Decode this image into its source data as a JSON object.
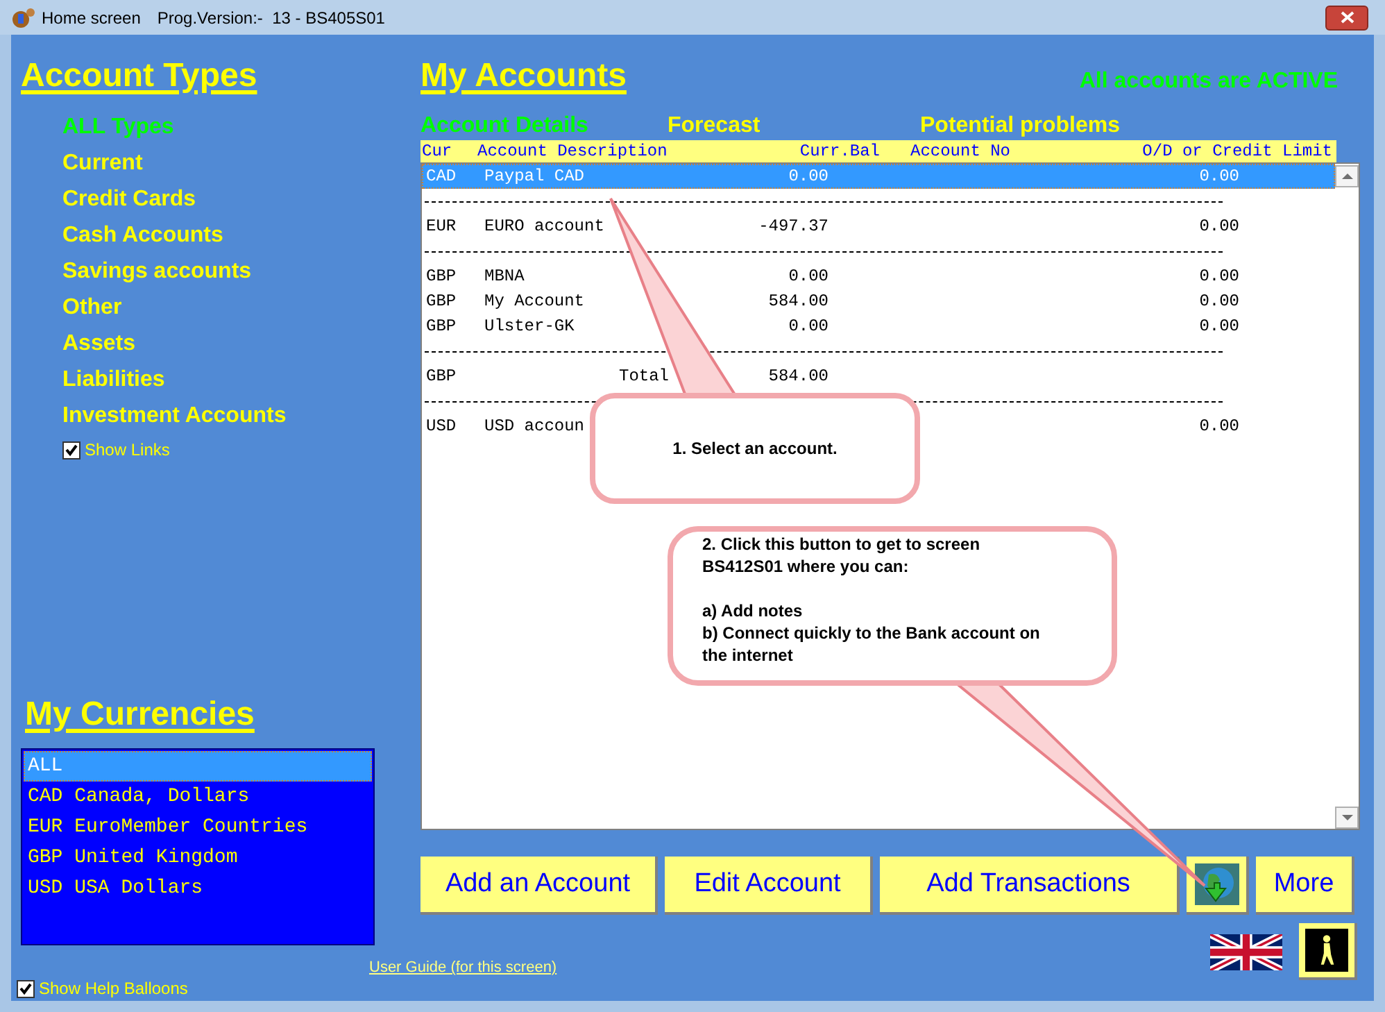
{
  "window": {
    "title": "Home screen",
    "version": "Prog.Version:-  13 - BS405S01"
  },
  "account_types": {
    "heading": "Account Types",
    "items": [
      {
        "label": "ALL Types",
        "selected": true
      },
      {
        "label": "Current",
        "selected": false
      },
      {
        "label": "Credit Cards",
        "selected": false
      },
      {
        "label": "Cash Accounts",
        "selected": false
      },
      {
        "label": "Savings accounts",
        "selected": false
      },
      {
        "label": "Other",
        "selected": false
      },
      {
        "label": "Assets",
        "selected": false
      },
      {
        "label": "Liabilities",
        "selected": false
      },
      {
        "label": "Investment Accounts",
        "selected": false
      }
    ],
    "show_links": {
      "label": "Show Links",
      "checked": true
    }
  },
  "currencies": {
    "heading": "My Currencies",
    "items": [
      {
        "label": "ALL",
        "selected": true
      },
      {
        "label": "CAD Canada, Dollars",
        "selected": false
      },
      {
        "label": "EUR EuroMember Countries",
        "selected": false
      },
      {
        "label": "GBP United Kingdom",
        "selected": false
      },
      {
        "label": "USD USA Dollars",
        "selected": false
      }
    ]
  },
  "show_help_balloons": {
    "label": "Show Help Balloons",
    "checked": true
  },
  "user_guide_link": "User Guide (for this screen)",
  "accounts": {
    "heading": "My Accounts",
    "status": "All accounts are ACTIVE",
    "tabs": [
      {
        "label": "Account Details",
        "selected": true
      },
      {
        "label": "Forecast",
        "selected": false
      },
      {
        "label": "Potential problems",
        "selected": false
      }
    ],
    "columns": [
      "Cur",
      "Account Description",
      "Curr.Bal",
      "Account No",
      "O/D or Credit Limit"
    ],
    "rows": [
      {
        "kind": "account",
        "cur": "CAD",
        "description": "Paypal CAD",
        "balance": "0.00",
        "limit": "0.00",
        "selected": true
      },
      {
        "kind": "separator"
      },
      {
        "kind": "account",
        "cur": "EUR",
        "description": "EURO account",
        "balance": "-497.37",
        "limit": "0.00",
        "selected": false
      },
      {
        "kind": "separator"
      },
      {
        "kind": "account",
        "cur": "GBP",
        "description": "MBNA",
        "balance": "0.00",
        "limit": "0.00",
        "selected": false
      },
      {
        "kind": "account",
        "cur": "GBP",
        "description": "My Account",
        "balance": "584.00",
        "limit": "0.00",
        "selected": false
      },
      {
        "kind": "account",
        "cur": "GBP",
        "description": "Ulster-GK",
        "balance": "0.00",
        "limit": "0.00",
        "selected": false
      },
      {
        "kind": "separator"
      },
      {
        "kind": "total",
        "cur": "GBP",
        "description": "Total",
        "balance": "584.00"
      },
      {
        "kind": "separator"
      },
      {
        "kind": "account",
        "cur": "USD",
        "description": "USD accoun",
        "limit": "0.00",
        "selected": false
      }
    ]
  },
  "buttons": [
    "Add an Account",
    "Edit Account",
    "Add Transactions",
    "More"
  ],
  "callouts": [
    "1. Select an account.",
    "2. Click this button to get to screen\nBS412S01 where you can:\n\na) Add notes\nb) Connect quickly to the Bank account on\nthe internet"
  ]
}
